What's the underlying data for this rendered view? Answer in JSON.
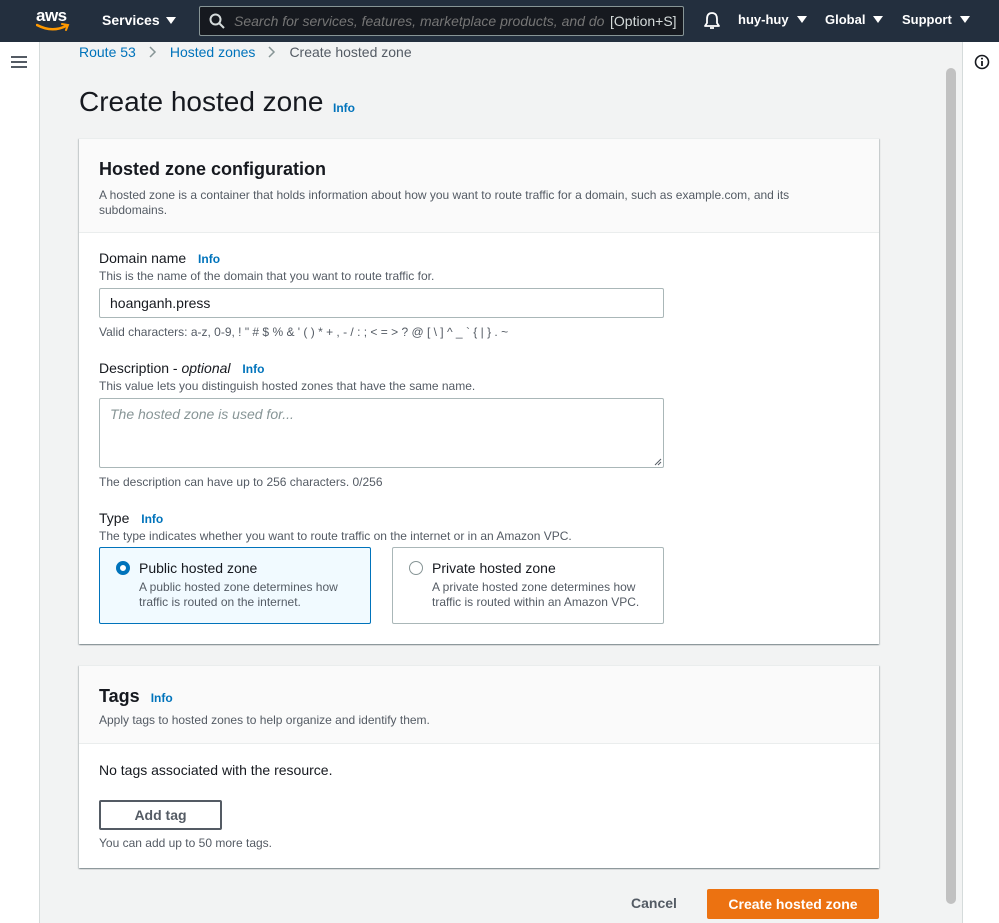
{
  "topnav": {
    "logo_text": "aws",
    "services_label": "Services",
    "search_placeholder": "Search for services, features, marketplace products, and docs",
    "search_shortcut": "[Option+S]",
    "account_label": "huy-huy",
    "region_label": "Global",
    "support_label": "Support"
  },
  "breadcrumb": {
    "items": [
      "Route 53",
      "Hosted zones",
      "Create hosted zone"
    ]
  },
  "page": {
    "title": "Create hosted zone",
    "info_label": "Info"
  },
  "config_panel": {
    "title": "Hosted zone configuration",
    "description": "A hosted zone is a container that holds information about how you want to route traffic for a domain, such as example.com, and its subdomains.",
    "domain": {
      "label": "Domain name",
      "info": "Info",
      "description": "This is the name of the domain that you want to route traffic for.",
      "value": "hoanganh.press",
      "constraint": "Valid characters: a-z, 0-9, ! \" # $ % & ' ( ) * + , - / : ; < = > ? @ [ \\ ] ^ _ ` { | } . ~"
    },
    "description_field": {
      "label": "Description - ",
      "label_optional": "optional",
      "info": "Info",
      "description": "This value lets you distinguish hosted zones that have the same name.",
      "placeholder": "The hosted zone is used for...",
      "constraint": "The description can have up to 256 characters. 0/256"
    },
    "type": {
      "label": "Type",
      "info": "Info",
      "description": "The type indicates whether you want to route traffic on the internet or in an Amazon VPC.",
      "options": [
        {
          "title": "Public hosted zone",
          "description": "A public hosted zone determines how traffic is routed on the internet.",
          "selected": true
        },
        {
          "title": "Private hosted zone",
          "description": "A private hosted zone determines how traffic is routed within an Amazon VPC.",
          "selected": false
        }
      ]
    }
  },
  "tags_panel": {
    "title": "Tags",
    "info": "Info",
    "description": "Apply tags to hosted zones to help organize and identify them.",
    "empty_text": "No tags associated with the resource.",
    "add_button": "Add tag",
    "limit_text": "You can add up to 50 more tags."
  },
  "footer": {
    "cancel_label": "Cancel",
    "create_label": "Create hosted zone"
  },
  "colors": {
    "nav_bg": "#232f3e",
    "link": "#0073bb",
    "primary_button": "#ec7211",
    "aws_smile": "#ff9900"
  }
}
